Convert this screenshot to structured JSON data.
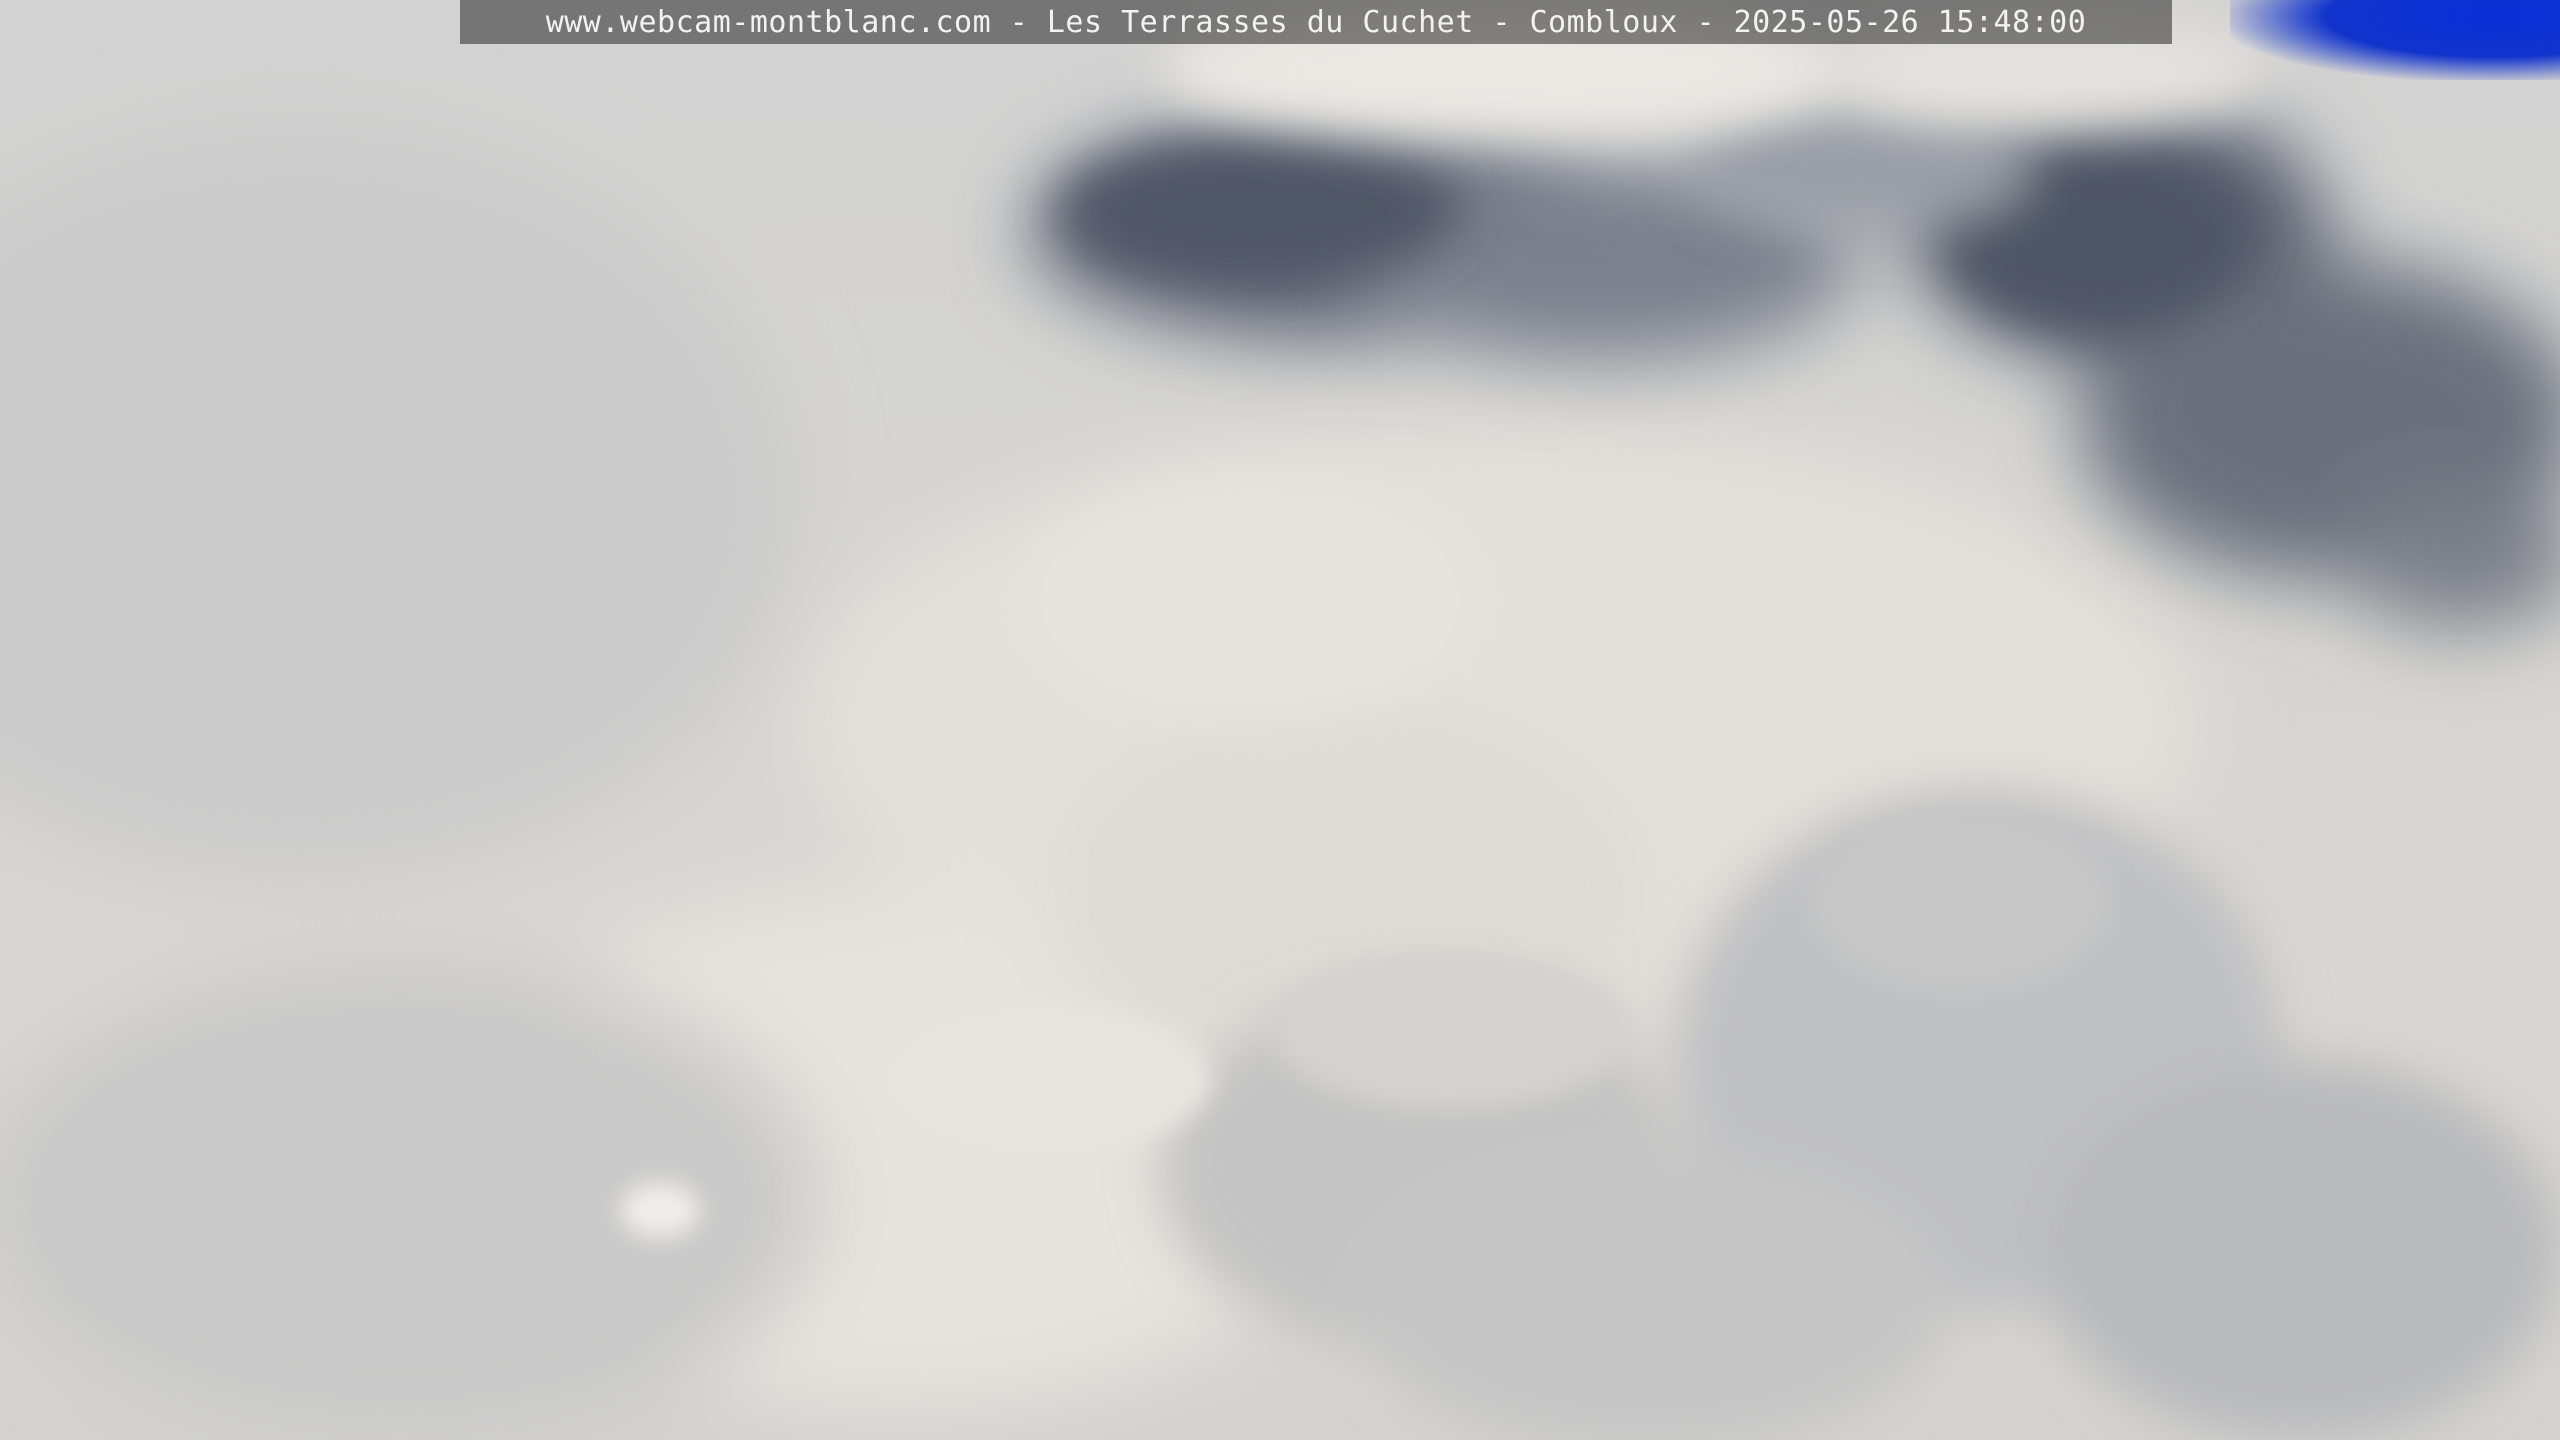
{
  "overlay": {
    "caption": "www.webcam-montblanc.com - Les Terrasses du Cuchet - Combloux - 2025-05-26 15:48:00"
  },
  "scene": {
    "subject": "cloudy-sky",
    "colors": {
      "cloud_light": "#e6e3dd",
      "cloud_mid": "#c8c8c8",
      "cloud_dark": "#5a6170",
      "sky_blue": "#0a2ed8"
    }
  }
}
